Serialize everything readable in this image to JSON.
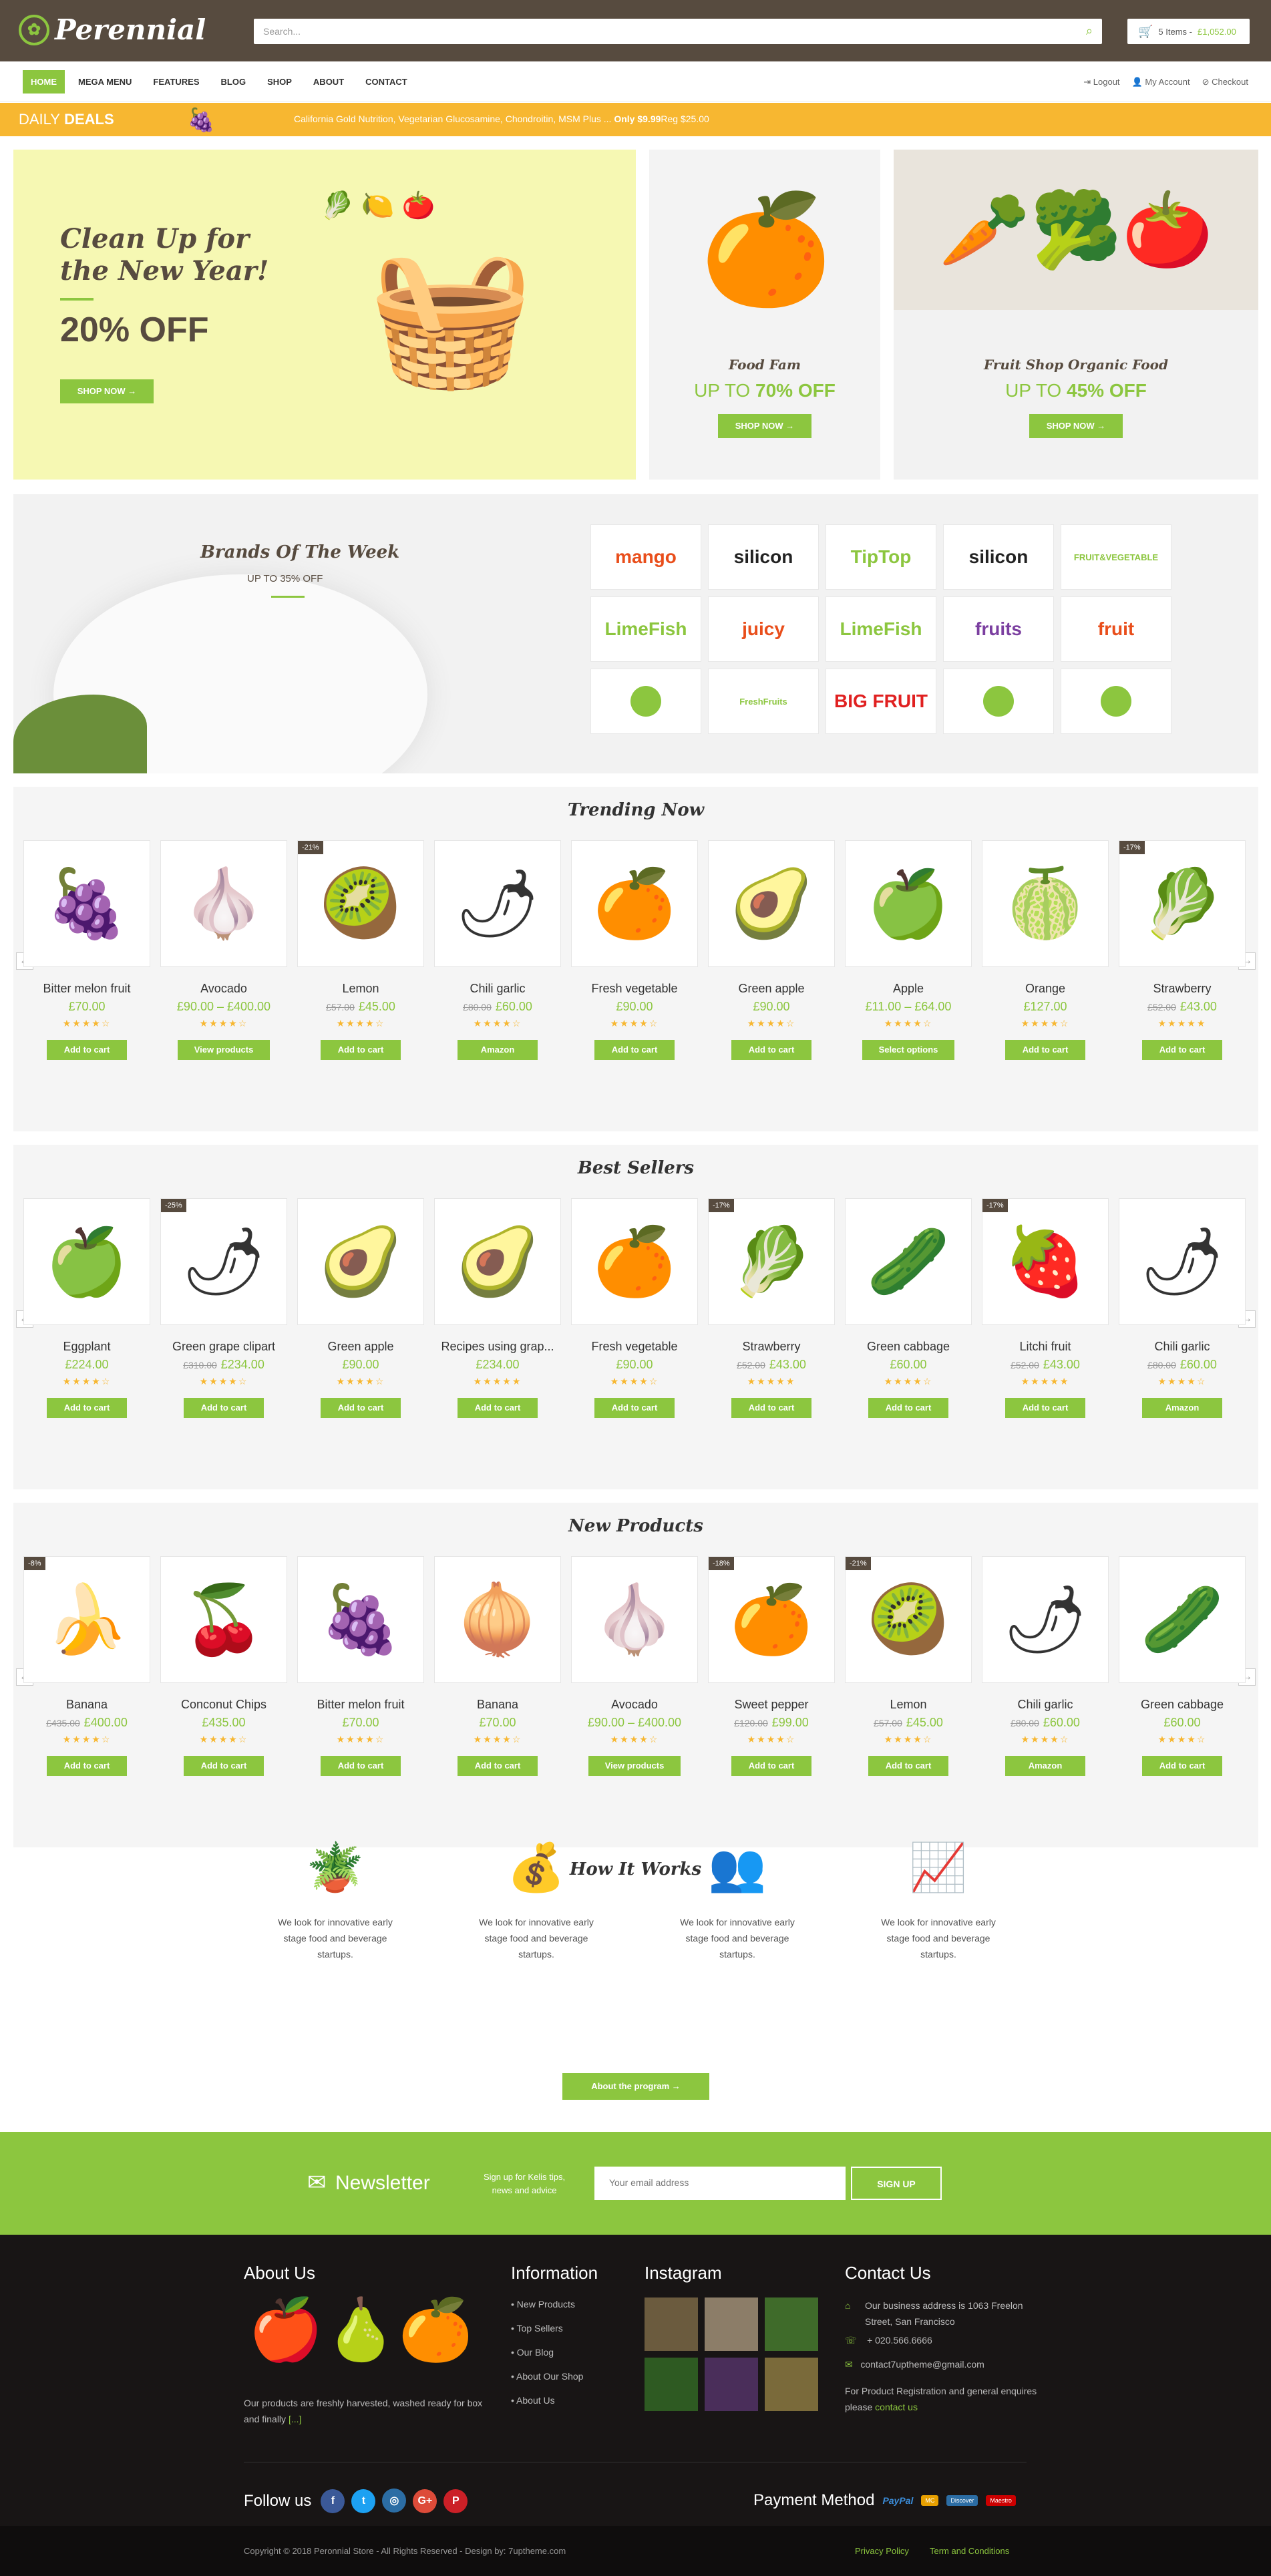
{
  "header": {
    "logo_text": "Perennial",
    "search_placeholder": "Search...",
    "cart_text": "5 Items -",
    "cart_total": "£1,052.00"
  },
  "nav": {
    "items": [
      "HOME",
      "MEGA MENU",
      "FEATURES",
      "BLOG",
      "SHOP",
      "ABOUT",
      "CONTACT"
    ],
    "right": [
      "Logout",
      "My Account",
      "Checkout"
    ]
  },
  "deals": {
    "label_a": "DAILY",
    "label_b": "DEALS",
    "text": "California Gold Nutrition, Vegetarian Glucosamine, Chondroitin, MSM Plus ...",
    "price_prefix": "Only",
    "price": "$9.99",
    "reg": "Reg $25.00"
  },
  "banners": {
    "b1_title_line1": "Clean Up for",
    "b1_title_line2": "the New Year!",
    "b1_off": "20% OFF",
    "b1_btn": "SHOP NOW",
    "b2_title": "Food Fam",
    "b2_off_prefix": "UP TO",
    "b2_off": "70% OFF",
    "b2_btn": "SHOP NOW",
    "b3_title": "Fruit Shop Organic Food",
    "b3_off_prefix": "UP TO",
    "b3_off": "45% OFF",
    "b3_btn": "SHOP NOW"
  },
  "brands": {
    "title": "Brands Of The Week",
    "sub": "UP TO 35% OFF",
    "logos": [
      {
        "text": "mango",
        "color": "#e94e1b"
      },
      {
        "text": "silicon",
        "color": "#222222"
      },
      {
        "text": "TipTop",
        "color": "#8cc63f"
      },
      {
        "text": "silicon",
        "color": "#222222"
      },
      {
        "text": "FRUIT&VEGETABLE",
        "color": "#8cc63f"
      },
      {
        "text": "LimeFish",
        "color": "#8cc63f"
      },
      {
        "text": "juicy",
        "color": "#e94e1b"
      },
      {
        "text": "LimeFish",
        "color": "#8cc63f"
      },
      {
        "text": "fruits",
        "color": "#7b3fa0"
      },
      {
        "text": "fruit",
        "color": "#e94e1b"
      },
      {
        "text": "",
        "color": "#8cc63f"
      },
      {
        "text": "FreshFruits",
        "color": "#8cc63f"
      },
      {
        "text": "BIG FRUIT",
        "color": "#e02020"
      },
      {
        "text": "",
        "color": "#8cc63f"
      },
      {
        "text": "",
        "color": "#8cc63f"
      }
    ]
  },
  "sections": [
    {
      "title": "Trending Now",
      "products": [
        {
          "name": "Bitter melon fruit",
          "price": "£70.00",
          "old": "",
          "sale": "",
          "rating": 4,
          "btn": "Add to cart",
          "emoji": "🍇"
        },
        {
          "name": "Avocado",
          "price": "£90.00 – £400.00",
          "old": "",
          "sale": "",
          "rating": 4,
          "btn": "View products",
          "emoji": "🧄"
        },
        {
          "name": "Lemon",
          "price": "£45.00",
          "old": "£57.00",
          "sale": "-21%",
          "rating": 4,
          "btn": "Add to cart",
          "emoji": "🥝"
        },
        {
          "name": "Chili garlic",
          "price": "£60.00",
          "old": "£80.00",
          "sale": "",
          "rating": 4,
          "btn": "Amazon",
          "emoji": "🌶"
        },
        {
          "name": "Fresh vegetable",
          "price": "£90.00",
          "old": "",
          "sale": "",
          "rating": 4,
          "btn": "Add to cart",
          "emoji": "🍊"
        },
        {
          "name": "Green apple",
          "price": "£90.00",
          "old": "",
          "sale": "",
          "rating": 4,
          "btn": "Add to cart",
          "emoji": "🥑"
        },
        {
          "name": "Apple",
          "price": "£11.00 – £64.00",
          "old": "",
          "sale": "",
          "rating": 4,
          "btn": "Select options",
          "emoji": "🍏"
        },
        {
          "name": "Orange",
          "price": "£127.00",
          "old": "",
          "sale": "",
          "rating": 4,
          "btn": "Add to cart",
          "emoji": "🍈"
        },
        {
          "name": "Strawberry",
          "price": "£43.00",
          "old": "£52.00",
          "sale": "-17%",
          "rating": 5,
          "btn": "Add to cart",
          "emoji": "🥬"
        }
      ]
    },
    {
      "title": "Best Sellers",
      "products": [
        {
          "name": "Eggplant",
          "price": "£224.00",
          "old": "",
          "sale": "",
          "rating": 4,
          "btn": "Add to cart",
          "emoji": "🍏"
        },
        {
          "name": "Green grape clipart",
          "price": "£234.00",
          "old": "£310.00",
          "sale": "-25%",
          "rating": 4,
          "btn": "Add to cart",
          "emoji": "🌶"
        },
        {
          "name": "Green apple",
          "price": "£90.00",
          "old": "",
          "sale": "",
          "rating": 4,
          "btn": "Add to cart",
          "emoji": "🥑"
        },
        {
          "name": "Recipes using grap...",
          "price": "£234.00",
          "old": "",
          "sale": "",
          "rating": 5,
          "btn": "Add to cart",
          "emoji": "🥑"
        },
        {
          "name": "Fresh vegetable",
          "price": "£90.00",
          "old": "",
          "sale": "",
          "rating": 4,
          "btn": "Add to cart",
          "emoji": "🍊"
        },
        {
          "name": "Strawberry",
          "price": "£43.00",
          "old": "£52.00",
          "sale": "-17%",
          "rating": 5,
          "btn": "Add to cart",
          "emoji": "🥬"
        },
        {
          "name": "Green cabbage",
          "price": "£60.00",
          "old": "",
          "sale": "",
          "rating": 4,
          "btn": "Add to cart",
          "emoji": "🥒"
        },
        {
          "name": "Litchi fruit",
          "price": "£43.00",
          "old": "£52.00",
          "sale": "-17%",
          "rating": 5,
          "btn": "Add to cart",
          "emoji": "🍓"
        },
        {
          "name": "Chili garlic",
          "price": "£60.00",
          "old": "£80.00",
          "sale": "",
          "rating": 4,
          "btn": "Amazon",
          "emoji": "🌶"
        }
      ]
    },
    {
      "title": "New Products",
      "products": [
        {
          "name": "Banana",
          "price": "£400.00",
          "old": "£435.00",
          "sale": "-8%",
          "rating": 4,
          "btn": "Add to cart",
          "emoji": "🍌"
        },
        {
          "name": "Conconut Chips",
          "price": "£435.00",
          "old": "",
          "sale": "",
          "rating": 4,
          "btn": "Add to cart",
          "emoji": "🍒"
        },
        {
          "name": "Bitter melon fruit",
          "price": "£70.00",
          "old": "",
          "sale": "",
          "rating": 4,
          "btn": "Add to cart",
          "emoji": "🍇"
        },
        {
          "name": "Banana",
          "price": "£70.00",
          "old": "",
          "sale": "",
          "rating": 4,
          "btn": "Add to cart",
          "emoji": "🧅"
        },
        {
          "name": "Avocado",
          "price": "£90.00 – £400.00",
          "old": "",
          "sale": "",
          "rating": 4,
          "btn": "View products",
          "emoji": "🧄"
        },
        {
          "name": "Sweet pepper",
          "price": "£99.00",
          "old": "£120.00",
          "sale": "-18%",
          "rating": 4,
          "btn": "Add to cart",
          "emoji": "🍊"
        },
        {
          "name": "Lemon",
          "price": "£45.00",
          "old": "£57.00",
          "sale": "-21%",
          "rating": 4,
          "btn": "Add to cart",
          "emoji": "🥝"
        },
        {
          "name": "Chili garlic",
          "price": "£60.00",
          "old": "£80.00",
          "sale": "",
          "rating": 4,
          "btn": "Amazon",
          "emoji": "🌶"
        },
        {
          "name": "Green cabbage",
          "price": "£60.00",
          "old": "",
          "sale": "",
          "rating": 4,
          "btn": "Add to cart",
          "emoji": "🥒"
        }
      ]
    }
  ],
  "how": {
    "title": "How It Works",
    "items": [
      {
        "icon": "plant-pot-icon",
        "text": "We look for innovative early stage food and beverage startups."
      },
      {
        "icon": "money-bag-icon",
        "text": "We look for innovative early stage food and beverage startups."
      },
      {
        "icon": "team-icon",
        "text": "We look for innovative early stage food and beverage startups."
      },
      {
        "icon": "growth-chart-icon",
        "text": "We look for innovative early stage food and beverage startups."
      }
    ],
    "btn": "About the program"
  },
  "newsletter": {
    "title": "Newsletter",
    "sub": "Sign up for Kelis tips, news and advice",
    "placeholder": "Your email address",
    "btn": "SIGN UP"
  },
  "footer": {
    "about_title": "About Us",
    "about_text": "Our products are freshly harvested, washed ready for box and finally",
    "about_more": "[...]",
    "info_title": "Information",
    "info_links": [
      "New Products",
      "Top Sellers",
      "Our Blog",
      "About Our Shop",
      "About Us"
    ],
    "insta_title": "Instagram",
    "contact_title": "Contact Us",
    "address": "Our business address is 1063 Freelon Street, San Francisco",
    "phone": "+ 020.566.6666",
    "email": "contact7uptheme@gmail.com",
    "enquiry": "For Product Registration and general enquires please",
    "enquiry_link": "contact us",
    "follow": "Follow us",
    "payment": "Payment Method",
    "payment_cards": [
      "PayPal",
      "MC",
      "Discover",
      "Maestro"
    ],
    "copyright": "Copyright © 2018 Peronnial Store - All Rights Reserved - Design by: 7uptheme.com",
    "policy": "Privacy Policy",
    "terms": "Term and Conditions"
  }
}
